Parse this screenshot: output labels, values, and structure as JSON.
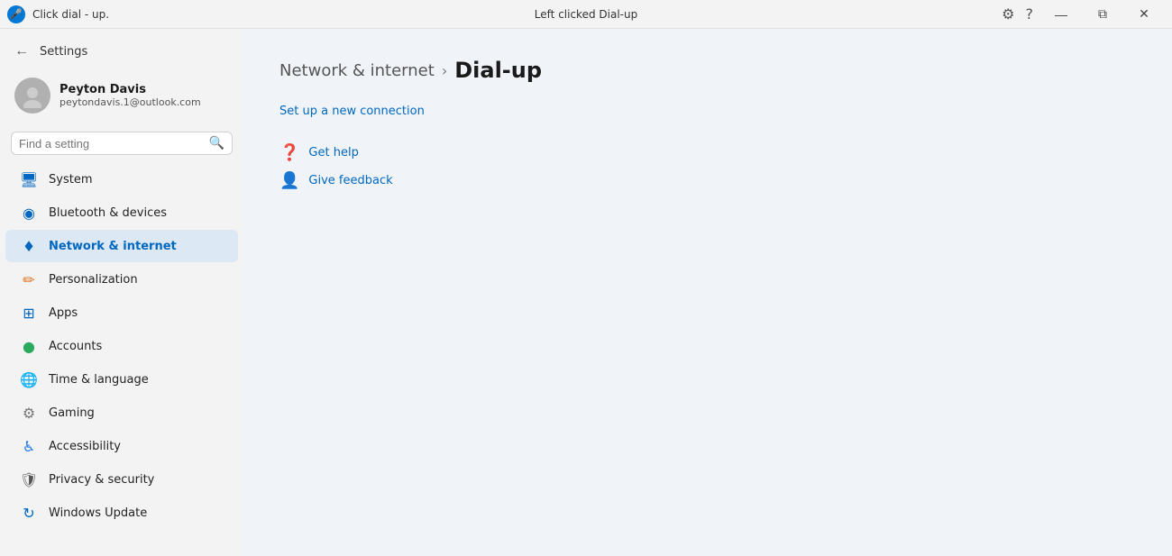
{
  "titlebar": {
    "app_icon_label": "🎤",
    "app_title": "Click dial - up.",
    "center_title": "Left clicked Dial-up",
    "settings_icon": "⚙",
    "help_icon": "?",
    "minimize": "—",
    "restore": "⧉",
    "close": "✕"
  },
  "sidebar": {
    "nav_back_label": "←",
    "settings_label": "Settings",
    "user": {
      "name": "Peyton Davis",
      "email": "peytondavis.1@outlook.com"
    },
    "search": {
      "placeholder": "Find a setting"
    },
    "items": [
      {
        "id": "system",
        "label": "System",
        "icon": "🖥",
        "active": false
      },
      {
        "id": "bluetooth",
        "label": "Bluetooth & devices",
        "icon": "🔵",
        "active": false
      },
      {
        "id": "network",
        "label": "Network & internet",
        "icon": "💠",
        "active": true
      },
      {
        "id": "personalization",
        "label": "Personalization",
        "icon": "✏",
        "active": false
      },
      {
        "id": "apps",
        "label": "Apps",
        "icon": "🟦",
        "active": false
      },
      {
        "id": "accounts",
        "label": "Accounts",
        "icon": "🟢",
        "active": false
      },
      {
        "id": "time",
        "label": "Time & language",
        "icon": "🌐",
        "active": false
      },
      {
        "id": "gaming",
        "label": "Gaming",
        "icon": "🎮",
        "active": false
      },
      {
        "id": "accessibility",
        "label": "Accessibility",
        "icon": "♿",
        "active": false
      },
      {
        "id": "privacy",
        "label": "Privacy & security",
        "icon": "🛡",
        "active": false
      },
      {
        "id": "update",
        "label": "Windows Update",
        "icon": "🔄",
        "active": false
      }
    ]
  },
  "main": {
    "breadcrumb_parent": "Network & internet",
    "breadcrumb_sep": "›",
    "breadcrumb_current": "Dial-up",
    "setup_link": "Set up a new connection",
    "help_items": [
      {
        "id": "get-help",
        "label": "Get help",
        "icon": "❓"
      },
      {
        "id": "give-feedback",
        "label": "Give feedback",
        "icon": "👤"
      }
    ]
  }
}
